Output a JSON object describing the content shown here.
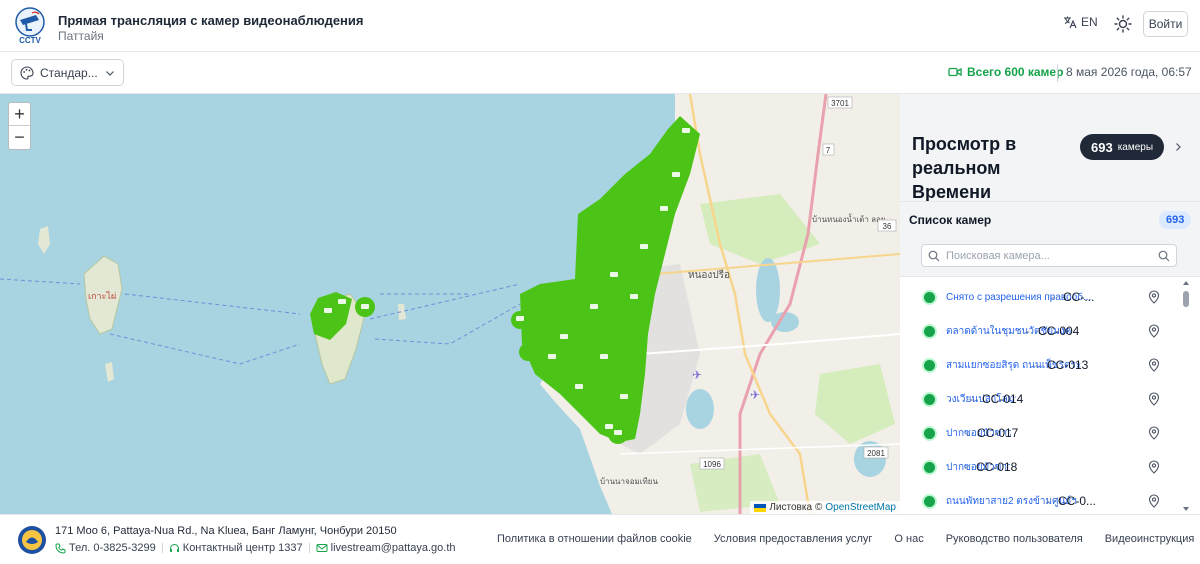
{
  "header": {
    "title": "Прямая трансляция с камер видеонаблюдения",
    "subtitle": "Паттайя",
    "logo_text": "CCTV",
    "lang_label": "EN",
    "login_label": "Войти"
  },
  "toolbar": {
    "style_select": "Стандар...",
    "camera_total": "Всего 600 камер",
    "datetime": "8 мая 2026 года, 06:57"
  },
  "map": {
    "zoom_in": "+",
    "zoom_out": "−",
    "attribution_prefix": "Листовка",
    "attribution_copy": "©",
    "attribution_link": "OpenStreetMap",
    "labels": {
      "island": "เกาะไผ่",
      "district": "หนองปรือ",
      "village": "บ้านหนองน้ำเต้า\nลอย",
      "south": "บ้านนาจอมเทียน",
      "road_3701": "3701",
      "road_7": "7",
      "road_1096": "1096",
      "road_2081": "2081",
      "road_36": "36"
    }
  },
  "panel": {
    "live_title": "Просмотр в реальном Времени",
    "count_number": "693",
    "count_unit": "камеры",
    "list_label": "Список камер",
    "list_count": "693",
    "search_placeholder": "Поисковая камера...",
    "cameras": [
      {
        "name": "Снято с разрешения правооб...",
        "code": "СС-..."
      },
      {
        "name": "ตลาดด้านในชุมชนวัดชัยมงคล2",
        "code": "СС-004"
      },
      {
        "name": "สามแยกซอยสิรุด ถนนเพ็ชรตระกูล",
        "code": "СС-013"
      },
      {
        "name": "วงเวียนปลาโลมา",
        "code": "СС-014"
      },
      {
        "name": "ปากซอยบัวขาว",
        "code": "СС-017"
      },
      {
        "name": "ปากซอยบัวขาว",
        "code": "СС-018"
      },
      {
        "name": "ถนนพัทยาสาย2 ตรงข้ามศูนย์ฯ",
        "code": "СС-0..."
      }
    ]
  },
  "footer": {
    "address": "171 Moo 6, Pattaya-Nua Rd., Na Kluea, Банг Ламунг, Чонбури 20150",
    "phone": "Тел. 0-3825-3299",
    "contact_center": "Контактный центр 1337",
    "email": "livestream@pattaya.go.th",
    "links": [
      "Политика в отношении файлов cookie",
      "Условия предоставления услуг",
      "О нас",
      "Руководство пользователя",
      "Видеоинструкция"
    ]
  },
  "colors": {
    "accent_green": "#16a34a",
    "cluster_green": "#4cc417",
    "sea": "#a8d3e1",
    "land": "#f2efe9",
    "link_blue": "#2563eb"
  }
}
